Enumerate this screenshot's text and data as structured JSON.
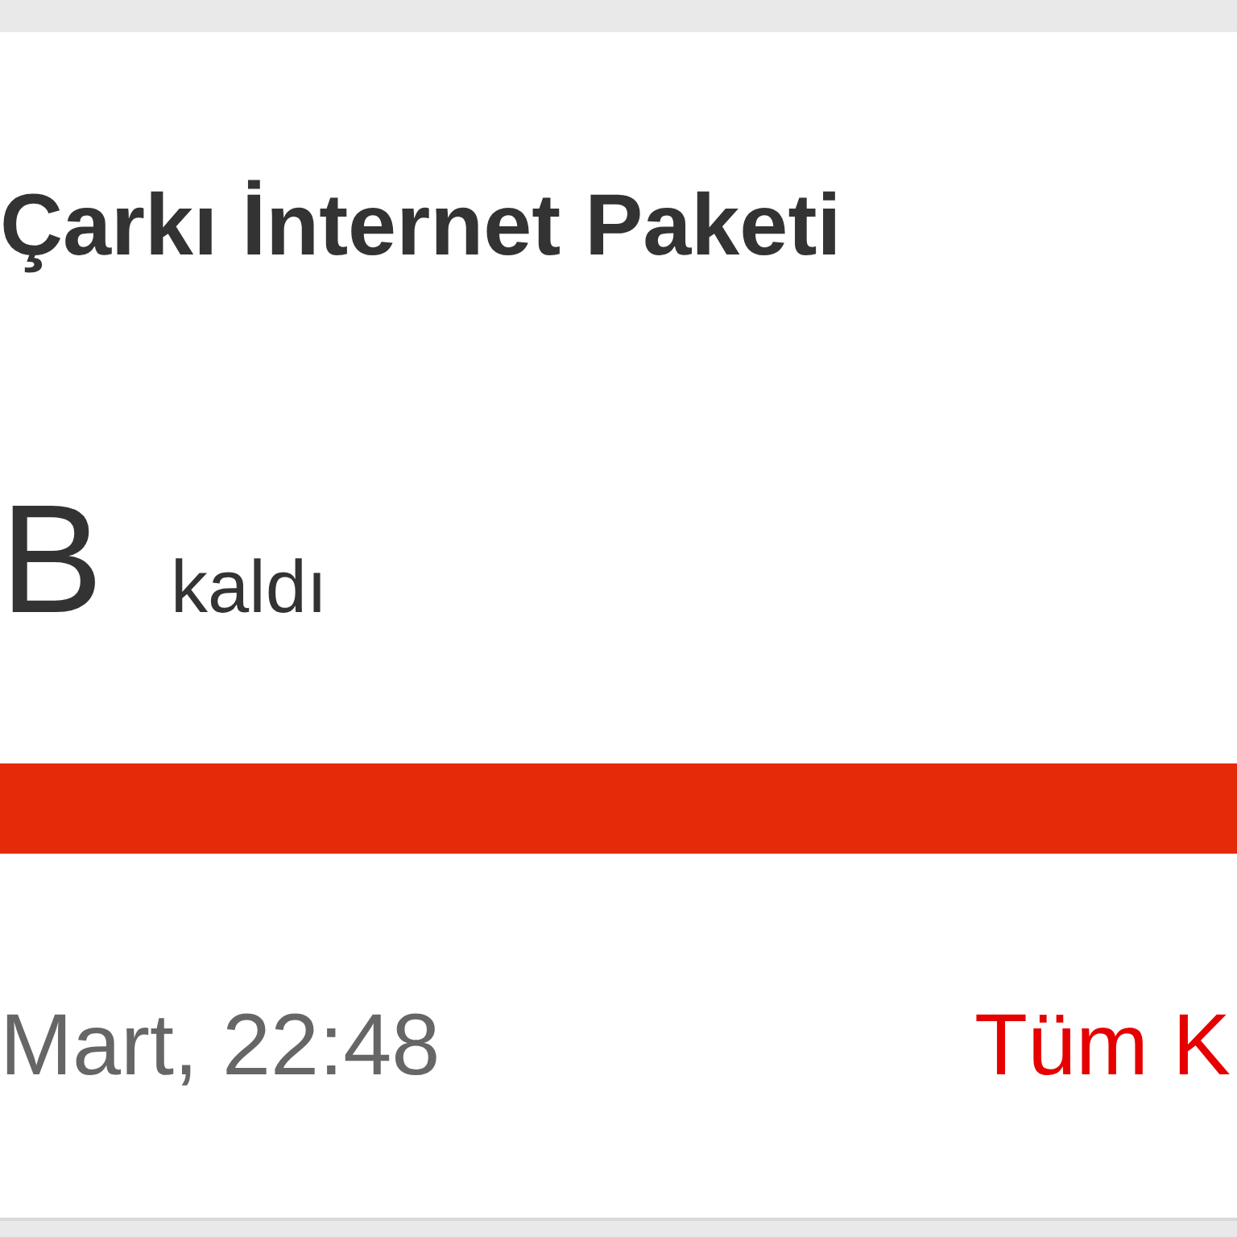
{
  "package": {
    "title": "Çarkı İnternet Paketi",
    "amount": "B",
    "remaining_label": "kaldı",
    "usage": {
      "level": 1
    },
    "updated": "Mart, 22:48",
    "all_link": "Tüm K"
  }
}
